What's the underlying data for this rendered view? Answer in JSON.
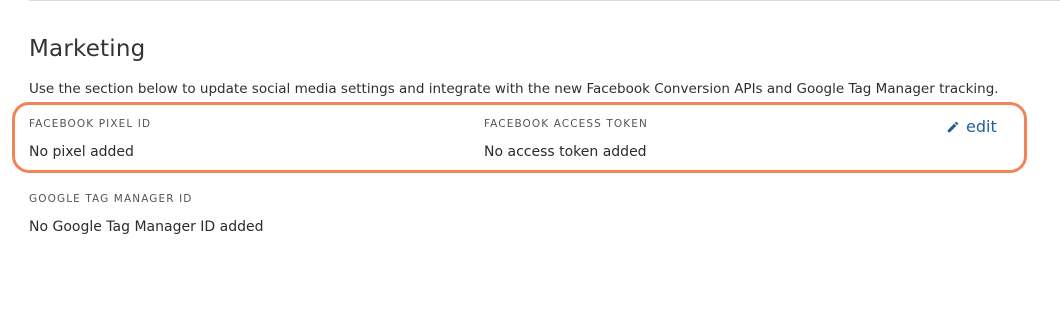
{
  "section": {
    "title": "Marketing",
    "description": "Use the section below to update social media settings and integrate with the new Facebook Conversion APIs and Google Tag Manager tracking."
  },
  "facebook": {
    "pixel_label": "FACEBOOK PIXEL ID",
    "pixel_value": "No pixel added",
    "token_label": "FACEBOOK ACCESS TOKEN",
    "token_value": "No access token added",
    "edit_label": "edit",
    "edit_icon": "pencil-icon"
  },
  "google": {
    "gtm_label": "GOOGLE TAG MANAGER ID",
    "gtm_value": "No Google Tag Manager ID added"
  },
  "colors": {
    "highlight_border": "#f08457",
    "link": "#1f5f9e"
  }
}
